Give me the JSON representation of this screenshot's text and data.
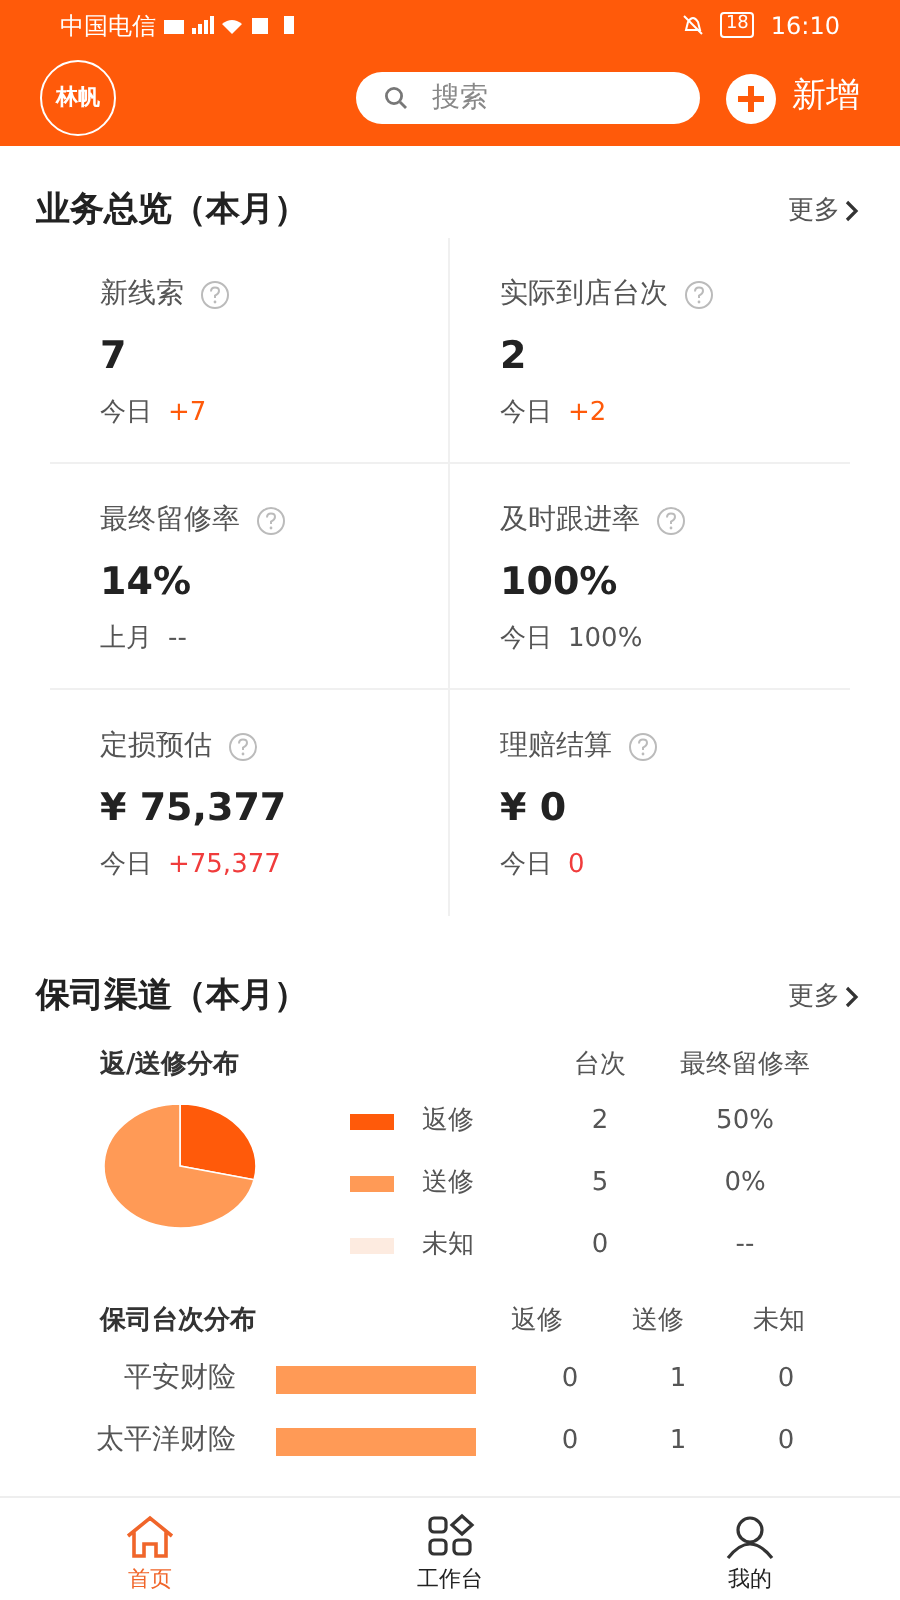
{
  "status_bar": {
    "carrier": "中国电信",
    "battery": "18",
    "time": "16:10"
  },
  "header": {
    "avatar": "林帆",
    "search": {
      "placeholder": "搜索"
    },
    "add_button": "新增"
  },
  "overview": {
    "title": "业务总览（本月）",
    "more": "更多",
    "metrics": [
      {
        "label": "新线索",
        "value": "7",
        "sub_label": "今日",
        "sub_value": "+7",
        "color": "#ff5a0a"
      },
      {
        "label": "实际到店台次",
        "value": "2",
        "sub_label": "今日",
        "sub_value": "+2",
        "color": "#ff5a0a"
      },
      {
        "label": "最终留修率",
        "value": "14%",
        "sub_label": "上月",
        "sub_value": "--",
        "color": "#555555"
      },
      {
        "label": "及时跟进率",
        "value": "100%",
        "sub_label": "今日",
        "sub_value": "100%",
        "color": "#555555"
      },
      {
        "label": "定损预估",
        "value": "¥ 75,377",
        "sub_label": "今日",
        "sub_value": "+75,377",
        "color": "#f03c3c"
      },
      {
        "label": "理赔结算",
        "value": "¥ 0",
        "sub_label": "今日",
        "sub_value": "0",
        "color": "#f03c3c"
      }
    ]
  },
  "channels": {
    "title": "保司渠道（本月）",
    "more": "更多",
    "distribution": {
      "title": "返/送修分布",
      "columns": [
        "台次",
        "最终留修率"
      ],
      "rows": [
        {
          "name": "返修",
          "count": "2",
          "rate": "50%",
          "color": "#ff5a0a"
        },
        {
          "name": "送修",
          "count": "5",
          "rate": "0%",
          "color": "#ff9a56"
        },
        {
          "name": "未知",
          "count": "0",
          "rate": "--",
          "color": "#fdebe0"
        }
      ]
    },
    "insurers": {
      "title": "保司台次分布",
      "columns": [
        "返修",
        "送修",
        "未知"
      ],
      "rows": [
        {
          "name": "平安财险",
          "values": [
            "0",
            "1",
            "0"
          ]
        },
        {
          "name": "太平洋财险",
          "values": [
            "0",
            "1",
            "0"
          ]
        }
      ]
    }
  },
  "tabbar": [
    {
      "label": "首页",
      "selected": true
    },
    {
      "label": "工作台",
      "selected": false
    },
    {
      "label": "我的",
      "selected": false
    }
  ]
}
